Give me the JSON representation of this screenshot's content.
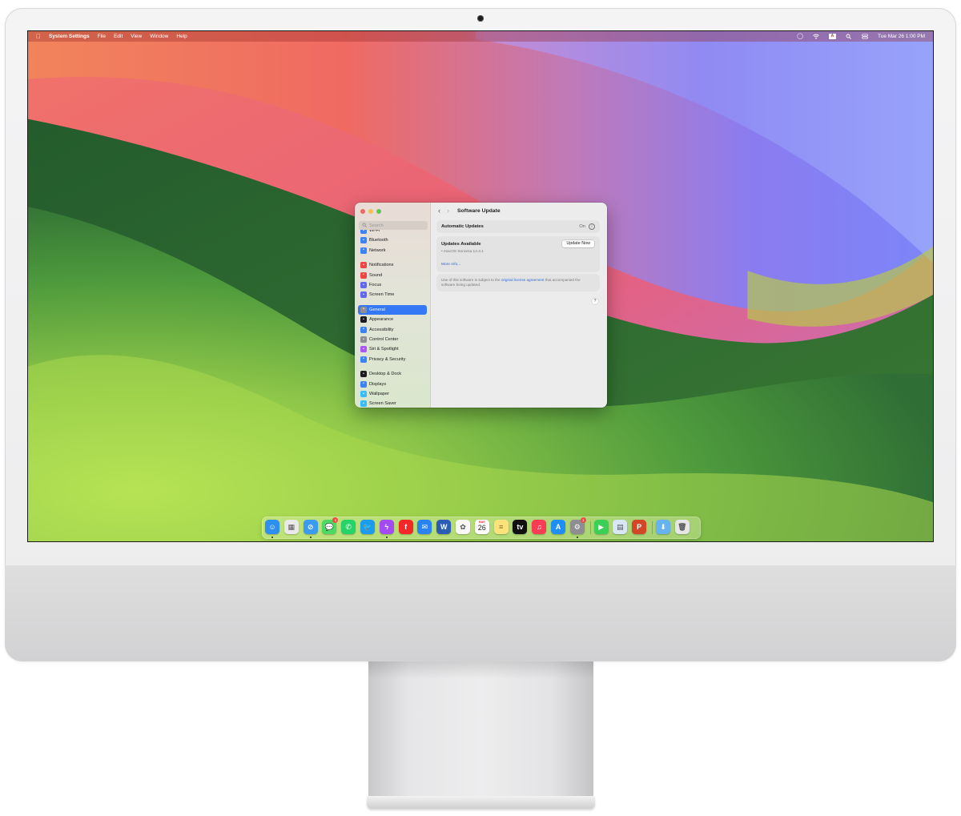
{
  "menubar": {
    "app_name": "System Settings",
    "menus": [
      "File",
      "Edit",
      "View",
      "Window",
      "Help"
    ],
    "status_icons": [
      "siri-icon",
      "wifi-icon",
      "keyboard-input-icon",
      "search-icon",
      "control-center-icon"
    ],
    "input_source": "A",
    "datetime": "Tue Mar 26  1:00 PM"
  },
  "window": {
    "title": "Software Update",
    "search_placeholder": "Search",
    "sidebar_items": [
      {
        "label": "Wi-Fi",
        "icon": "wifi-icon",
        "color": "#3b82f6"
      },
      {
        "label": "Bluetooth",
        "icon": "bluetooth-icon",
        "color": "#3b82f6"
      },
      {
        "label": "Network",
        "icon": "globe-icon",
        "color": "#3b82f6"
      },
      {
        "label": "Notifications",
        "icon": "bell-icon",
        "color": "#ef4444"
      },
      {
        "label": "Sound",
        "icon": "speaker-icon",
        "color": "#ef4444"
      },
      {
        "label": "Focus",
        "icon": "moon-icon",
        "color": "#6366f1"
      },
      {
        "label": "Screen Time",
        "icon": "hourglass-icon",
        "color": "#6366f1"
      },
      {
        "label": "General",
        "icon": "gear-icon",
        "color": "#8e8e93"
      },
      {
        "label": "Appearance",
        "icon": "appearance-icon",
        "color": "#1c1c1e"
      },
      {
        "label": "Accessibility",
        "icon": "accessibility-icon",
        "color": "#3b82f6"
      },
      {
        "label": "Control Center",
        "icon": "control-center-icon",
        "color": "#8e8e93"
      },
      {
        "label": "Siri & Spotlight",
        "icon": "siri-icon",
        "color": "#a855f7"
      },
      {
        "label": "Privacy & Security",
        "icon": "hand-icon",
        "color": "#3b82f6"
      },
      {
        "label": "Desktop & Dock",
        "icon": "dock-icon",
        "color": "#1c1c1e"
      },
      {
        "label": "Displays",
        "icon": "display-icon",
        "color": "#3b82f6"
      },
      {
        "label": "Wallpaper",
        "icon": "wallpaper-icon",
        "color": "#38bdf8"
      },
      {
        "label": "Screen Saver",
        "icon": "screensaver-icon",
        "color": "#38bdf8"
      }
    ],
    "selected_item": "General",
    "automatic_updates": {
      "label": "Automatic Updates",
      "status": "On"
    },
    "updates_available": {
      "title": "Updates Available",
      "item": "• macOS Sonoma 14.4.1",
      "button": "Update Now",
      "more_info": "More Info..."
    },
    "license": {
      "before": "Use of this software is subject to the ",
      "link": "original license agreement",
      "after": " that accompanied the software being updated."
    },
    "help_label": "?"
  },
  "dock": {
    "apps": [
      {
        "name": "finder",
        "color": "#2f8ff0",
        "glyph": "☺",
        "running": true
      },
      {
        "name": "launchpad",
        "color": "#e9e9ea",
        "glyph": "▦",
        "running": false
      },
      {
        "name": "safari",
        "color": "#3a9bf0",
        "glyph": "⊘",
        "running": true
      },
      {
        "name": "messages",
        "color": "#4cd964",
        "glyph": "💬",
        "running": false,
        "badge": "1"
      },
      {
        "name": "whatsapp",
        "color": "#25d366",
        "glyph": "✆",
        "running": false
      },
      {
        "name": "twitter",
        "color": "#1d9bf0",
        "glyph": "🐦",
        "running": false
      },
      {
        "name": "messenger",
        "color": "#a34bf5",
        "glyph": "ϟ",
        "running": true
      },
      {
        "name": "flipboard",
        "color": "#f52828",
        "glyph": "f",
        "running": false
      },
      {
        "name": "mail",
        "color": "#2a83f2",
        "glyph": "✉",
        "running": false
      },
      {
        "name": "word",
        "color": "#2b5cb6",
        "glyph": "W",
        "running": false
      },
      {
        "name": "photos",
        "color": "#f7f7f7",
        "glyph": "✿",
        "running": false
      },
      {
        "name": "calendar",
        "color": "#ffffff",
        "glyph": "",
        "running": false,
        "month": "MAR",
        "day": "26"
      },
      {
        "name": "notes",
        "color": "#fbe27a",
        "glyph": "≡",
        "running": false
      },
      {
        "name": "apple-tv",
        "color": "#111111",
        "glyph": "tv",
        "running": false
      },
      {
        "name": "music",
        "color": "#fa3c55",
        "glyph": "♫",
        "running": false
      },
      {
        "name": "app-store",
        "color": "#1f8ff5",
        "glyph": "A",
        "running": false
      },
      {
        "name": "system-settings",
        "color": "#8d8d92",
        "glyph": "⚙",
        "running": true,
        "badge": "1"
      },
      {
        "name": "facetime",
        "color": "#3ccf55",
        "glyph": "▶",
        "running": false
      },
      {
        "name": "preview",
        "color": "#d9e6f5",
        "glyph": "▤",
        "running": false
      },
      {
        "name": "powerpoint",
        "color": "#d24726",
        "glyph": "P",
        "running": false
      },
      {
        "name": "downloads-folder",
        "color": "#67b3f1",
        "glyph": "⬇",
        "running": false
      },
      {
        "name": "trash",
        "color": "#e6e6e6",
        "glyph": "🗑",
        "running": false
      }
    ]
  }
}
